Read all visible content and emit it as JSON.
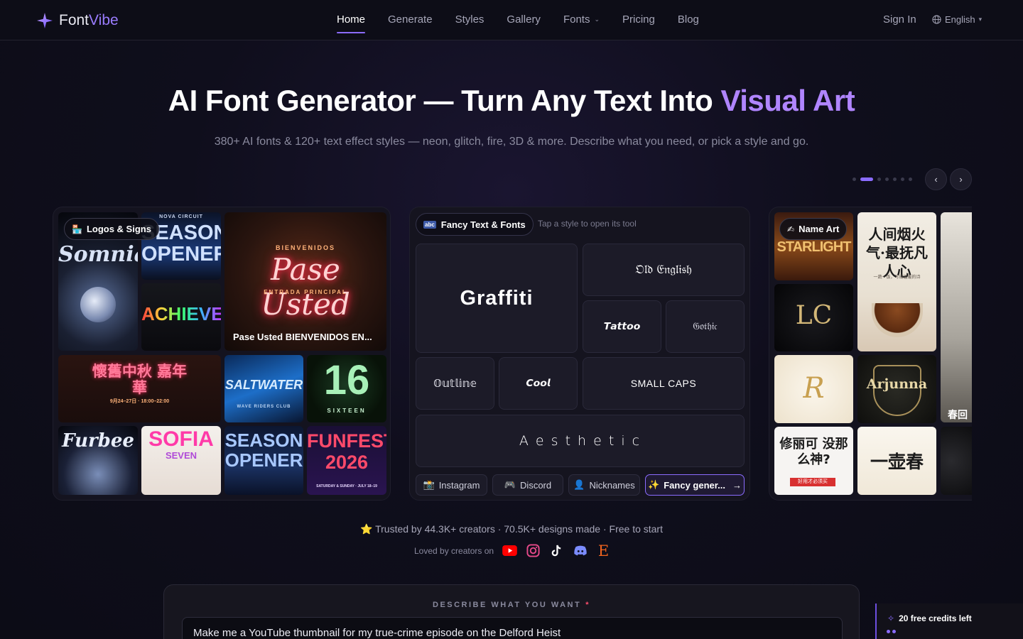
{
  "brand": {
    "name_part1": "Font",
    "name_part2": "Vibe"
  },
  "nav": {
    "links": [
      {
        "label": "Home"
      },
      {
        "label": "Generate"
      },
      {
        "label": "Styles"
      },
      {
        "label": "Gallery"
      },
      {
        "label": "Fonts"
      },
      {
        "label": "Pricing"
      },
      {
        "label": "Blog"
      }
    ],
    "sign_in": "Sign In",
    "language": "English"
  },
  "hero": {
    "title_main": "AI Font Generator — Turn Any Text Into ",
    "title_accent": "Visual Art",
    "subtitle": "380+ AI fonts & 120+ text effect styles — neon, glitch, fire, 3D & more. Describe what you need, or pick a style and go."
  },
  "carousel": {
    "active_index": 1,
    "dot_count": 8
  },
  "left_panel": {
    "chip_label": "Logos & Signs",
    "tiles": [
      {
        "text": "Somnia"
      },
      {
        "text": "SEASON OPENER",
        "sub": "NOVA CIRCUIT"
      },
      {
        "text": "ACHIEVE"
      },
      {
        "text": "Pase Usted",
        "top": "BIENVENIDOS",
        "bottom": "ENTRADA PRINCIPAL"
      },
      {
        "text": "懷舊中秋 嘉年華",
        "sub": "9月24–27日 · 18:00–22:00"
      },
      {
        "text": "SALTWATER",
        "sub": "WAVE RIDERS CLUB"
      },
      {
        "text": "16",
        "sub": "SIXTEEN"
      },
      {
        "text": "Furbee"
      },
      {
        "text": "SOFIA",
        "sub": "SEVEN"
      },
      {
        "text": "SEASON OPENER"
      },
      {
        "text": "FUNFEST 2026",
        "sub": "SATURDAY & SUNDAY · JULY 18–19"
      }
    ],
    "caption": "Pase Usted BIENVENIDOS EN..."
  },
  "middle_panel": {
    "chip_label": "Fancy Text & Fonts",
    "chip_icon": "abc",
    "hint": "Tap a style to open its tool",
    "styles": [
      {
        "label": "Graffiti"
      },
      {
        "label": "𝔒𝔩𝔡 𝔈𝔫𝔤𝔩𝔦𝔰𝔥"
      },
      {
        "label": "𝙏𝙖𝙩𝙩𝙤𝙤"
      },
      {
        "label": "𝔊𝔬𝔱𝔥𝔦𝔠"
      },
      {
        "label": "𝕆𝕦𝕥𝕝𝕚𝕟𝕖"
      },
      {
        "label": "𝘾𝙤𝙤𝙡"
      },
      {
        "label": "SMALL CAPS"
      },
      {
        "label": "A e s t h e t i c"
      }
    ],
    "pills": [
      {
        "icon": "📸",
        "label": "Instagram"
      },
      {
        "icon": "🎮",
        "label": "Discord"
      },
      {
        "icon": "👤",
        "label": "Nicknames"
      },
      {
        "icon": "✨",
        "label": "Fancy gener..."
      }
    ]
  },
  "right_panel": {
    "chip_label": "Name Art",
    "tiles": [
      {
        "text": "STARLIGHT"
      },
      {
        "text": "人间烟火气·最抚凡人心",
        "sub": "一蔬一饭，写成温暖的诗"
      },
      {
        "text": "春回"
      },
      {
        "text": "LC"
      },
      {
        "text": "R"
      },
      {
        "text": "Arjunna"
      },
      {
        "text": "修丽可 没那么神?",
        "sub": "好用才必须买"
      },
      {
        "text": "一壶春"
      }
    ]
  },
  "trust": {
    "line": "⭐ Trusted by 44.3K+ creators · 70.5K+ designs made · Free to start",
    "loved_by": "Loved by creators on"
  },
  "prompt": {
    "label": "DESCRIBE WHAT YOU WANT",
    "required_mark": "*",
    "value": "Make me a YouTube thumbnail for my true-crime episode on the Delford Heist"
  },
  "credits": {
    "label": "20 free credits left"
  },
  "colors": {
    "accent": "#8b6cff",
    "accent_text": "#b085ff",
    "background": "#0f0e1c"
  }
}
